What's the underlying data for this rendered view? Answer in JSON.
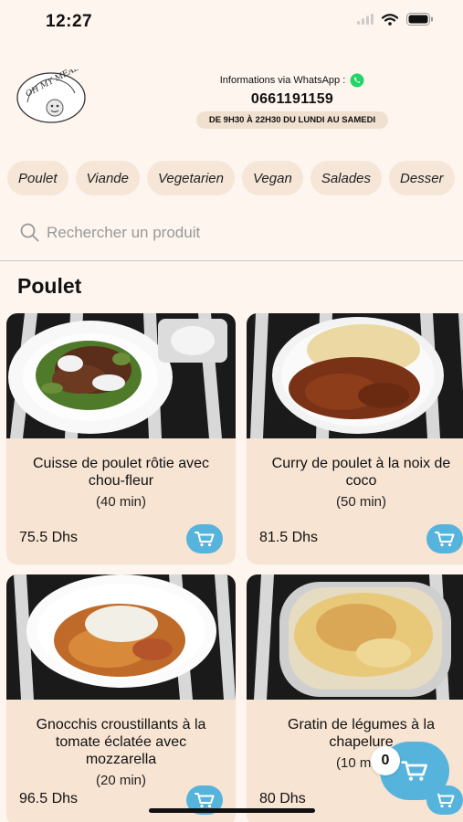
{
  "status_bar": {
    "time": "12:27"
  },
  "header": {
    "logo_text": "OH MY MEALS",
    "info_label": "Informations via WhatsApp :",
    "phone": "0661191159",
    "hours": "DE 9H30 À 22H30 DU LUNDI AU SAMEDI"
  },
  "categories": [
    "Poulet",
    "Viande",
    "Vegetarien",
    "Vegan",
    "Salades",
    "Desser"
  ],
  "search": {
    "placeholder": "Rechercher un produit"
  },
  "section": {
    "title": "Poulet"
  },
  "products": [
    {
      "name": "Cuisse de poulet rôtie avec chou-fleur",
      "time": "(40 min)",
      "price": "75.5 Dhs"
    },
    {
      "name": "Curry de poulet à la noix de coco",
      "time": "(50 min)",
      "price": "81.5 Dhs"
    },
    {
      "name": "Gnocchis croustillants à la tomate éclatée avec mozzarella",
      "time": "(20 min)",
      "price": "96.5 Dhs"
    },
    {
      "name": "Gratin de légumes à la chapelure",
      "time": "(10 min)",
      "price": "80 Dhs"
    }
  ],
  "cart": {
    "count": "0"
  },
  "colors": {
    "background": "#fdf5ee",
    "card": "#f7e4d3",
    "accent": "#56b4dc",
    "whatsapp": "#25d366"
  },
  "icons": [
    "wifi-icon",
    "battery-icon",
    "signal-icon",
    "whatsapp-icon",
    "search-icon",
    "cart-icon"
  ]
}
